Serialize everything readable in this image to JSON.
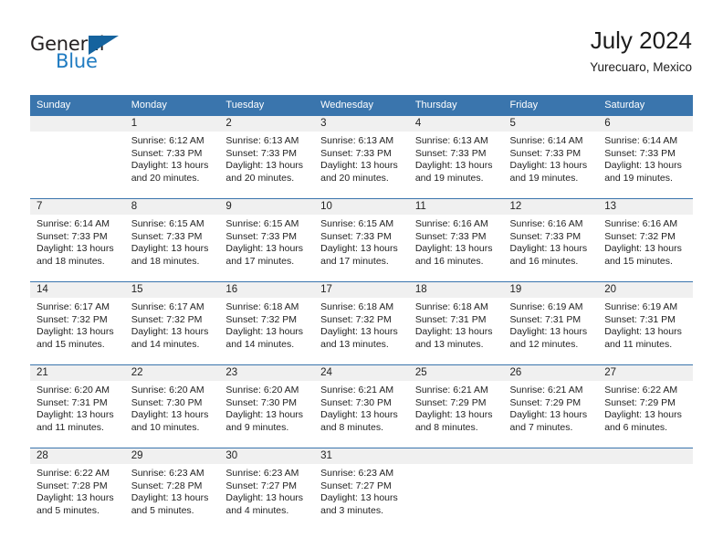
{
  "brand": {
    "word_general": "General",
    "word_blue": "Blue",
    "triangle_color": "#15639e",
    "blue_color": "#1f7bc1"
  },
  "header": {
    "title": "July 2024",
    "subtitle": "Yurecuaro, Mexico"
  },
  "theme": {
    "header_bg": "#3a75ad",
    "header_text": "#ffffff",
    "daynum_bg": "#f0f0f0",
    "grid_line": "#3a75ad"
  },
  "weekday_headers": [
    "Sunday",
    "Monday",
    "Tuesday",
    "Wednesday",
    "Thursday",
    "Friday",
    "Saturday"
  ],
  "labels": {
    "sunrise": "Sunrise:",
    "sunset": "Sunset:",
    "daylight": "Daylight:"
  },
  "weeks": [
    [
      {
        "day": "",
        "sunrise": "",
        "sunset": "",
        "daylight_line1": "",
        "daylight_line2": ""
      },
      {
        "day": "1",
        "sunrise": "Sunrise: 6:12 AM",
        "sunset": "Sunset: 7:33 PM",
        "daylight_line1": "Daylight: 13 hours",
        "daylight_line2": "and 20 minutes."
      },
      {
        "day": "2",
        "sunrise": "Sunrise: 6:13 AM",
        "sunset": "Sunset: 7:33 PM",
        "daylight_line1": "Daylight: 13 hours",
        "daylight_line2": "and 20 minutes."
      },
      {
        "day": "3",
        "sunrise": "Sunrise: 6:13 AM",
        "sunset": "Sunset: 7:33 PM",
        "daylight_line1": "Daylight: 13 hours",
        "daylight_line2": "and 20 minutes."
      },
      {
        "day": "4",
        "sunrise": "Sunrise: 6:13 AM",
        "sunset": "Sunset: 7:33 PM",
        "daylight_line1": "Daylight: 13 hours",
        "daylight_line2": "and 19 minutes."
      },
      {
        "day": "5",
        "sunrise": "Sunrise: 6:14 AM",
        "sunset": "Sunset: 7:33 PM",
        "daylight_line1": "Daylight: 13 hours",
        "daylight_line2": "and 19 minutes."
      },
      {
        "day": "6",
        "sunrise": "Sunrise: 6:14 AM",
        "sunset": "Sunset: 7:33 PM",
        "daylight_line1": "Daylight: 13 hours",
        "daylight_line2": "and 19 minutes."
      }
    ],
    [
      {
        "day": "7",
        "sunrise": "Sunrise: 6:14 AM",
        "sunset": "Sunset: 7:33 PM",
        "daylight_line1": "Daylight: 13 hours",
        "daylight_line2": "and 18 minutes."
      },
      {
        "day": "8",
        "sunrise": "Sunrise: 6:15 AM",
        "sunset": "Sunset: 7:33 PM",
        "daylight_line1": "Daylight: 13 hours",
        "daylight_line2": "and 18 minutes."
      },
      {
        "day": "9",
        "sunrise": "Sunrise: 6:15 AM",
        "sunset": "Sunset: 7:33 PM",
        "daylight_line1": "Daylight: 13 hours",
        "daylight_line2": "and 17 minutes."
      },
      {
        "day": "10",
        "sunrise": "Sunrise: 6:15 AM",
        "sunset": "Sunset: 7:33 PM",
        "daylight_line1": "Daylight: 13 hours",
        "daylight_line2": "and 17 minutes."
      },
      {
        "day": "11",
        "sunrise": "Sunrise: 6:16 AM",
        "sunset": "Sunset: 7:33 PM",
        "daylight_line1": "Daylight: 13 hours",
        "daylight_line2": "and 16 minutes."
      },
      {
        "day": "12",
        "sunrise": "Sunrise: 6:16 AM",
        "sunset": "Sunset: 7:33 PM",
        "daylight_line1": "Daylight: 13 hours",
        "daylight_line2": "and 16 minutes."
      },
      {
        "day": "13",
        "sunrise": "Sunrise: 6:16 AM",
        "sunset": "Sunset: 7:32 PM",
        "daylight_line1": "Daylight: 13 hours",
        "daylight_line2": "and 15 minutes."
      }
    ],
    [
      {
        "day": "14",
        "sunrise": "Sunrise: 6:17 AM",
        "sunset": "Sunset: 7:32 PM",
        "daylight_line1": "Daylight: 13 hours",
        "daylight_line2": "and 15 minutes."
      },
      {
        "day": "15",
        "sunrise": "Sunrise: 6:17 AM",
        "sunset": "Sunset: 7:32 PM",
        "daylight_line1": "Daylight: 13 hours",
        "daylight_line2": "and 14 minutes."
      },
      {
        "day": "16",
        "sunrise": "Sunrise: 6:18 AM",
        "sunset": "Sunset: 7:32 PM",
        "daylight_line1": "Daylight: 13 hours",
        "daylight_line2": "and 14 minutes."
      },
      {
        "day": "17",
        "sunrise": "Sunrise: 6:18 AM",
        "sunset": "Sunset: 7:32 PM",
        "daylight_line1": "Daylight: 13 hours",
        "daylight_line2": "and 13 minutes."
      },
      {
        "day": "18",
        "sunrise": "Sunrise: 6:18 AM",
        "sunset": "Sunset: 7:31 PM",
        "daylight_line1": "Daylight: 13 hours",
        "daylight_line2": "and 13 minutes."
      },
      {
        "day": "19",
        "sunrise": "Sunrise: 6:19 AM",
        "sunset": "Sunset: 7:31 PM",
        "daylight_line1": "Daylight: 13 hours",
        "daylight_line2": "and 12 minutes."
      },
      {
        "day": "20",
        "sunrise": "Sunrise: 6:19 AM",
        "sunset": "Sunset: 7:31 PM",
        "daylight_line1": "Daylight: 13 hours",
        "daylight_line2": "and 11 minutes."
      }
    ],
    [
      {
        "day": "21",
        "sunrise": "Sunrise: 6:20 AM",
        "sunset": "Sunset: 7:31 PM",
        "daylight_line1": "Daylight: 13 hours",
        "daylight_line2": "and 11 minutes."
      },
      {
        "day": "22",
        "sunrise": "Sunrise: 6:20 AM",
        "sunset": "Sunset: 7:30 PM",
        "daylight_line1": "Daylight: 13 hours",
        "daylight_line2": "and 10 minutes."
      },
      {
        "day": "23",
        "sunrise": "Sunrise: 6:20 AM",
        "sunset": "Sunset: 7:30 PM",
        "daylight_line1": "Daylight: 13 hours",
        "daylight_line2": "and 9 minutes."
      },
      {
        "day": "24",
        "sunrise": "Sunrise: 6:21 AM",
        "sunset": "Sunset: 7:30 PM",
        "daylight_line1": "Daylight: 13 hours",
        "daylight_line2": "and 8 minutes."
      },
      {
        "day": "25",
        "sunrise": "Sunrise: 6:21 AM",
        "sunset": "Sunset: 7:29 PM",
        "daylight_line1": "Daylight: 13 hours",
        "daylight_line2": "and 8 minutes."
      },
      {
        "day": "26",
        "sunrise": "Sunrise: 6:21 AM",
        "sunset": "Sunset: 7:29 PM",
        "daylight_line1": "Daylight: 13 hours",
        "daylight_line2": "and 7 minutes."
      },
      {
        "day": "27",
        "sunrise": "Sunrise: 6:22 AM",
        "sunset": "Sunset: 7:29 PM",
        "daylight_line1": "Daylight: 13 hours",
        "daylight_line2": "and 6 minutes."
      }
    ],
    [
      {
        "day": "28",
        "sunrise": "Sunrise: 6:22 AM",
        "sunset": "Sunset: 7:28 PM",
        "daylight_line1": "Daylight: 13 hours",
        "daylight_line2": "and 5 minutes."
      },
      {
        "day": "29",
        "sunrise": "Sunrise: 6:23 AM",
        "sunset": "Sunset: 7:28 PM",
        "daylight_line1": "Daylight: 13 hours",
        "daylight_line2": "and 5 minutes."
      },
      {
        "day": "30",
        "sunrise": "Sunrise: 6:23 AM",
        "sunset": "Sunset: 7:27 PM",
        "daylight_line1": "Daylight: 13 hours",
        "daylight_line2": "and 4 minutes."
      },
      {
        "day": "31",
        "sunrise": "Sunrise: 6:23 AM",
        "sunset": "Sunset: 7:27 PM",
        "daylight_line1": "Daylight: 13 hours",
        "daylight_line2": "and 3 minutes."
      },
      {
        "day": "",
        "sunrise": "",
        "sunset": "",
        "daylight_line1": "",
        "daylight_line2": ""
      },
      {
        "day": "",
        "sunrise": "",
        "sunset": "",
        "daylight_line1": "",
        "daylight_line2": ""
      },
      {
        "day": "",
        "sunrise": "",
        "sunset": "",
        "daylight_line1": "",
        "daylight_line2": ""
      }
    ]
  ]
}
